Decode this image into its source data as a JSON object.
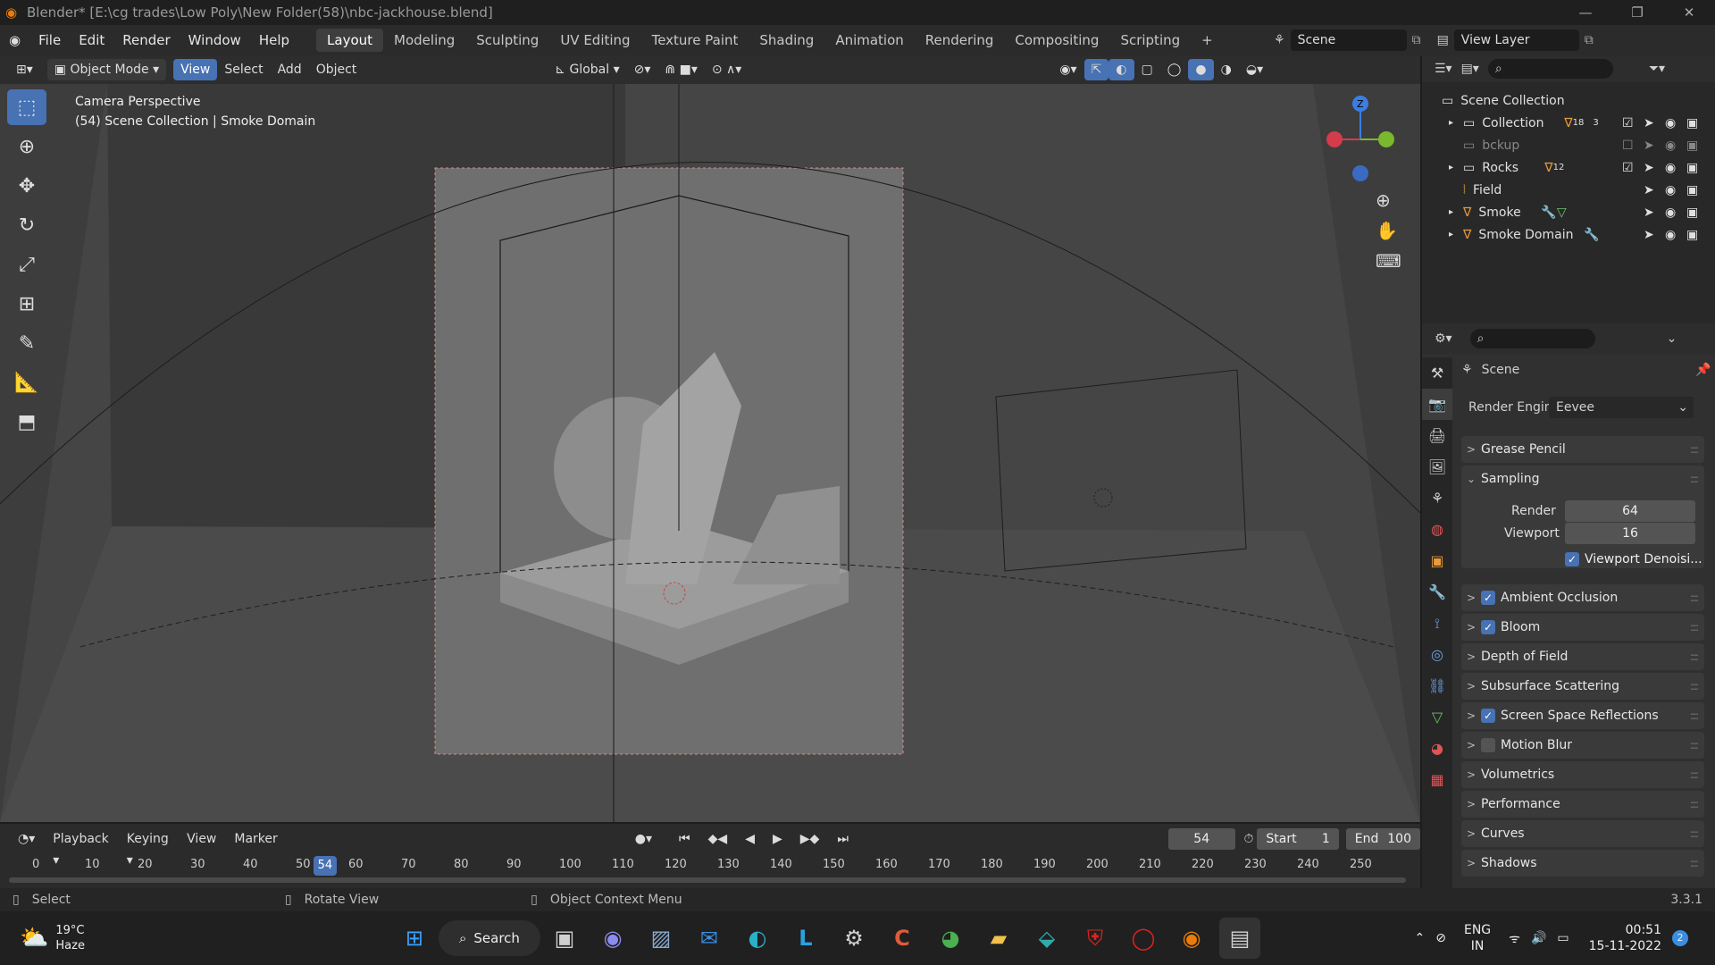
{
  "window": {
    "title": "Blender* [E:\\cg trades\\Low Poly\\New Folder(58)\\nbc-jackhouse.blend]"
  },
  "menu": [
    "File",
    "Edit",
    "Render",
    "Window",
    "Help"
  ],
  "workspaces": [
    "Layout",
    "Modeling",
    "Sculpting",
    "UV Editing",
    "Texture Paint",
    "Shading",
    "Animation",
    "Rendering",
    "Compositing",
    "Scripting",
    "+"
  ],
  "scene": {
    "name": "Scene",
    "view_layer": "View Layer"
  },
  "viewport_header": {
    "mode": "Object Mode",
    "view": "View",
    "select": "Select",
    "add": "Add",
    "object": "Object",
    "orientation": "Global"
  },
  "overlay": {
    "line1": "Camera Perspective",
    "line2": "(54) Scene Collection | Smoke Domain"
  },
  "outliner": {
    "root": "Scene Collection",
    "items": [
      {
        "label": "Collection",
        "badge": "18",
        "badge2": "3"
      },
      {
        "label": "bckup"
      },
      {
        "label": "Rocks",
        "badge": "12"
      },
      {
        "label": "Field"
      },
      {
        "label": "Smoke"
      },
      {
        "label": "Smoke Domain"
      }
    ]
  },
  "properties": {
    "context": "Scene",
    "render_engine_label": "Render Engine",
    "render_engine": "Eevee",
    "sampling": {
      "title": "Sampling",
      "render_label": "Render",
      "render": "64",
      "viewport_label": "Viewport",
      "viewport": "16",
      "denoise": "Viewport Denoisi..."
    },
    "panels": [
      {
        "label": "Grease Pencil",
        "check": null
      },
      {
        "label": "Ambient Occlusion",
        "check": true
      },
      {
        "label": "Bloom",
        "check": true
      },
      {
        "label": "Depth of Field",
        "check": null
      },
      {
        "label": "Subsurface Scattering",
        "check": null
      },
      {
        "label": "Screen Space Reflections",
        "check": true
      },
      {
        "label": "Motion Blur",
        "check": false
      },
      {
        "label": "Volumetrics",
        "check": null
      },
      {
        "label": "Performance",
        "check": null
      },
      {
        "label": "Curves",
        "check": null
      },
      {
        "label": "Shadows",
        "check": null
      }
    ]
  },
  "timeline": {
    "playback": "Playback",
    "keying": "Keying",
    "view": "View",
    "marker": "Marker",
    "current": "54",
    "start_label": "Start",
    "start": "1",
    "end_label": "End",
    "end": "100",
    "ticks": [
      "0",
      "10",
      "20",
      "30",
      "40",
      "50",
      "60",
      "70",
      "80",
      "90",
      "100",
      "110",
      "120",
      "130",
      "140",
      "150",
      "160",
      "170",
      "180",
      "190",
      "200",
      "210",
      "220",
      "230",
      "240",
      "250"
    ]
  },
  "status": {
    "select": "Select",
    "rotate": "Rotate View",
    "context": "Object Context Menu",
    "version": "3.3.1"
  },
  "taskbar": {
    "temp": "19°C",
    "weather": "Haze",
    "search": "Search",
    "lang1": "ENG",
    "lang2": "IN",
    "time": "00:51",
    "date": "15-11-2022",
    "notif": "2"
  }
}
